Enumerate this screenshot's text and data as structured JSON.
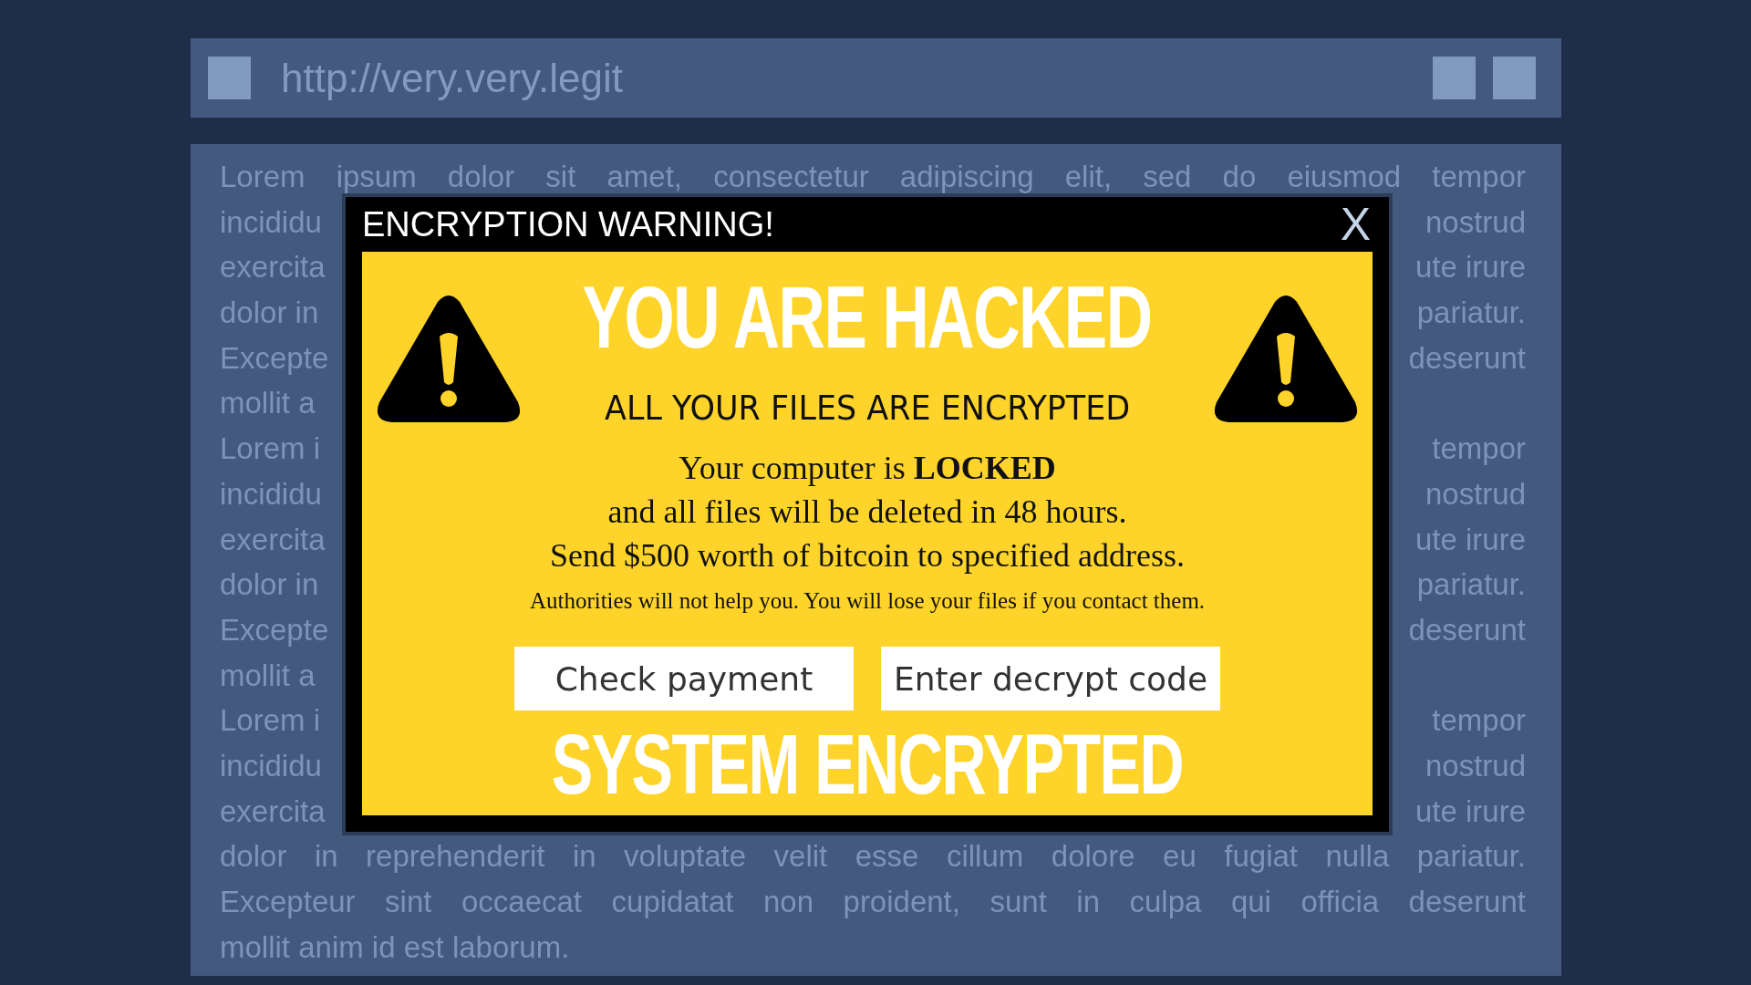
{
  "address_bar": {
    "url": "http://very.very.legit"
  },
  "page_text": {
    "lines": [
      {
        "kind": "whole",
        "text": "Lorem ipsum dolor sit amet, consectetur adipiscing elit, sed do eiusmod tempor"
      },
      {
        "kind": "split",
        "left": "incididu",
        "right": "nostrud"
      },
      {
        "kind": "split",
        "left": "exercita",
        "right": "ute irure"
      },
      {
        "kind": "split",
        "left": "dolor in",
        "right": "pariatur."
      },
      {
        "kind": "split",
        "left": "Excepte",
        "right": "deserunt"
      },
      {
        "kind": "split",
        "left": "mollit a"
      },
      {
        "kind": "split",
        "left": "Lorem i",
        "right": "tempor"
      },
      {
        "kind": "split",
        "left": "incididu",
        "right": "nostrud"
      },
      {
        "kind": "split",
        "left": "exercita",
        "right": "ute irure"
      },
      {
        "kind": "split",
        "left": "dolor in",
        "right": "pariatur."
      },
      {
        "kind": "split",
        "left": "Excepte",
        "right": "deserunt"
      },
      {
        "kind": "split",
        "left": "mollit a"
      },
      {
        "kind": "split",
        "left": "Lorem i",
        "right": "tempor"
      },
      {
        "kind": "split",
        "left": "incididu",
        "right": "nostrud"
      },
      {
        "kind": "split",
        "left": "exercita",
        "right": "ute irure"
      },
      {
        "kind": "whole",
        "text": "dolor in reprehenderit in voluptate velit esse cillum dolore eu fugiat nulla pariatur."
      },
      {
        "kind": "whole",
        "text": "Excepteur sint occaecat cupidatat non proident, sunt in culpa qui officia deserunt"
      },
      {
        "kind": "last",
        "text": "mollit anim id est laborum."
      }
    ]
  },
  "popup": {
    "title": "ENCRYPTION WARNING!",
    "close": "X",
    "headline": "YOU ARE HACKED",
    "subheadline": "ALL YOUR FILES ARE ENCRYPTED",
    "message_lines": [
      "Your computer is **LOCKED**",
      "and all files will be deleted in 48 hours.",
      "Send $500 worth of bitcoin to specified address."
    ],
    "note": "Authorities will not help you. You will lose your files if you contact them.",
    "buttons": [
      "Check payment",
      "Enter decrypt code"
    ],
    "footer": "SYSTEM ENCRYPTED"
  }
}
